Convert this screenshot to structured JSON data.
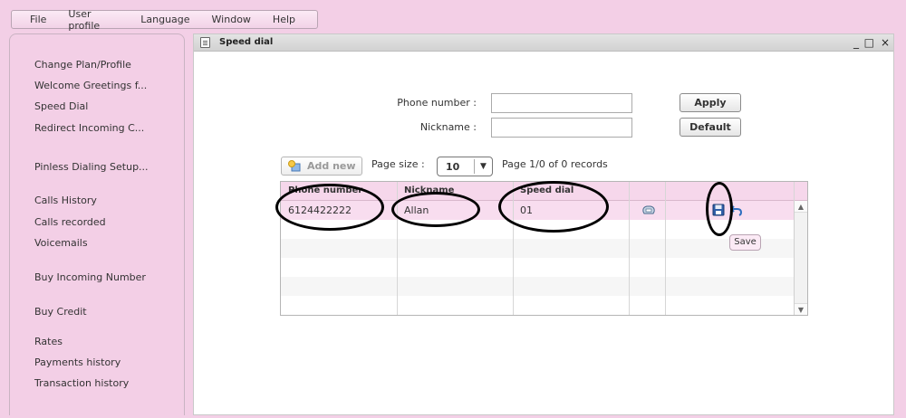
{
  "menu": [
    "File",
    "User profile",
    "Language",
    "Window",
    "Help"
  ],
  "sidebar": {
    "items": [
      "Change Plan/Profile",
      "Welcome Greetings f...",
      "Speed Dial",
      "Redirect Incoming C...",
      "Pinless Dialing Setup...",
      "Calls History",
      "Calls recorded",
      "Voicemails",
      "Buy Incoming Number",
      "Buy Credit",
      "Rates",
      "Payments history",
      "Transaction history"
    ]
  },
  "window": {
    "title": "Speed dial",
    "controls": [
      "_",
      "□",
      "×"
    ]
  },
  "form": {
    "phone_label": "Phone number :",
    "nickname_label": "Nickname :",
    "phone_value": "",
    "nickname_value": "",
    "apply_label": "Apply",
    "default_label": "Default"
  },
  "toolbar": {
    "add_new_label": "Add new",
    "page_size_label": "Page size :",
    "page_size_value": "10",
    "page_info": "Page 1/0 of 0 records"
  },
  "table": {
    "columns": [
      "Phone number",
      "Nickname",
      "Speed dial"
    ],
    "rows": [
      {
        "phone": "6124422222",
        "nickname": "Allan",
        "speed_dial": "01"
      }
    ]
  },
  "tooltip": "Save",
  "colors": {
    "accent": "#f3cfe6",
    "header": "#f6d7eb",
    "selected_row": "#f8ddef"
  },
  "icons": [
    "document-icon",
    "add-icon",
    "dropdown-arrow-icon",
    "phone-icon",
    "save-icon",
    "undo-icon",
    "scroll-up-icon",
    "scroll-down-icon"
  ]
}
